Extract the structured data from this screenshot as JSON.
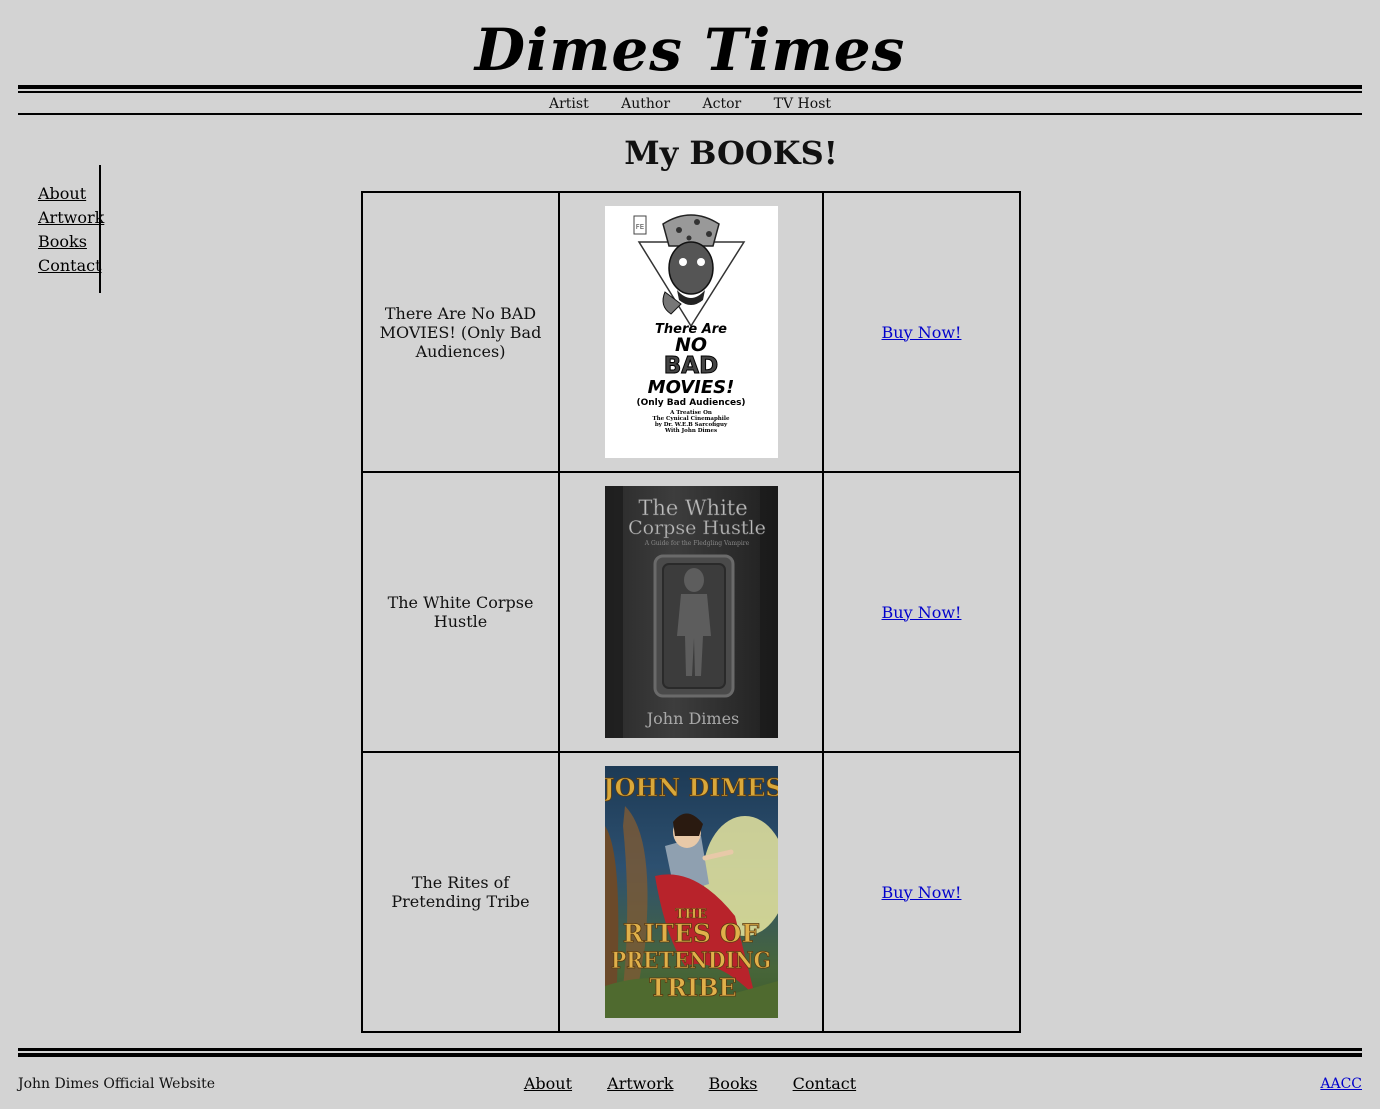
{
  "masthead": {
    "title": "Dimes Times"
  },
  "topnav": {
    "items": [
      "Artist",
      "Author",
      "Actor",
      "TV Host"
    ]
  },
  "sidebar": {
    "items": [
      "About",
      "Artwork",
      "Books",
      "Contact"
    ]
  },
  "main": {
    "title": "My BOOKS!",
    "books": [
      {
        "title": "There Are No BAD MOVIES! (Only Bad Audiences)",
        "buy_label": "Buy Now!",
        "cover": {
          "line1": "There Are",
          "line2": "NO",
          "line3": "BAD",
          "line4": "MOVIES!",
          "line5": "(Only Bad Audiences)",
          "line6": "A Treatise On",
          "line7": "The Cynical Cinemaphile",
          "line8": "by Dr. W.E.B Sarcofiguy",
          "line9": "With John Dimes"
        }
      },
      {
        "title": "The White Corpse Hustle",
        "buy_label": "Buy Now!",
        "cover": {
          "line1": "The White",
          "line2": "Corpse Hustle",
          "line3": "A Guide for the Fledgling Vampire",
          "author": "John Dimes"
        }
      },
      {
        "title": "The Rites of Pretending Tribe",
        "buy_label": "Buy Now!",
        "cover": {
          "author": "JOHN DIMES",
          "line1": "THE",
          "line2": "RITES OF",
          "line3": "PRETENDING",
          "line4": "TRIBE"
        }
      }
    ]
  },
  "footer": {
    "site_name": "John Dimes Official Website",
    "nav": [
      "About",
      "Artwork",
      "Books",
      "Contact"
    ],
    "right_link": "AACC"
  }
}
